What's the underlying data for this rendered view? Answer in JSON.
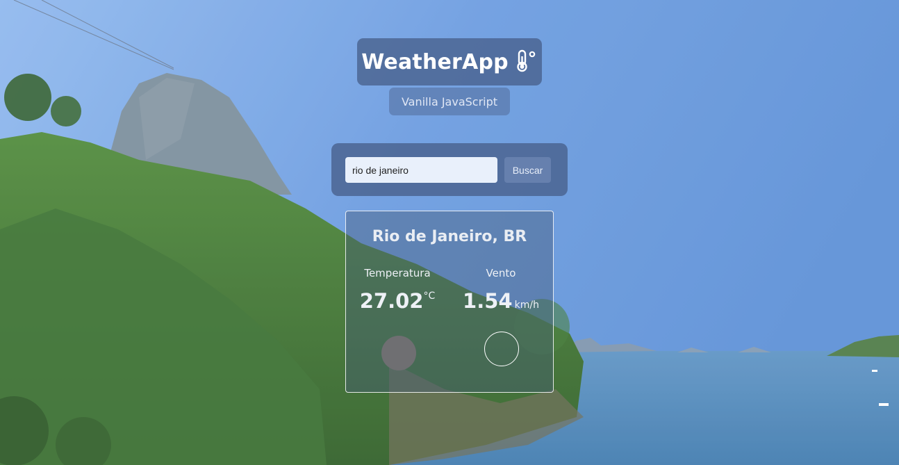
{
  "header": {
    "title": "WeatherApp",
    "title_icon": "thermometer-icon",
    "subtitle": "Vanilla JavaScript"
  },
  "search": {
    "value": "rio de janeiro",
    "button_label": "Buscar"
  },
  "weather": {
    "city": "Rio de Janeiro, BR",
    "temperature_label": "Temperatura",
    "temperature_value": "27.02",
    "temperature_unit": "°C",
    "wind_label": "Vento",
    "wind_value": "1.54",
    "wind_unit": "km/h",
    "weather_icon": "weather-condition-icon",
    "wind_icon": "wind-direction-icon"
  },
  "colors": {
    "panel": "#48608c",
    "input_bg": "#e9f0fb",
    "text": "#ffffff"
  }
}
